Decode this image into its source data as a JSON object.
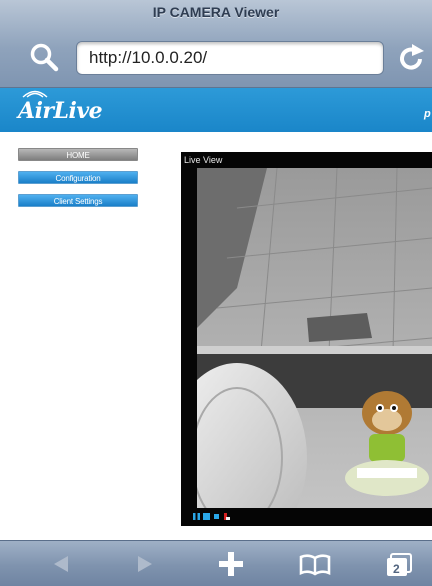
{
  "browser": {
    "title": "IP CAMERA Viewer",
    "url": "http://10.0.0.20/",
    "tab_count": "2"
  },
  "brand": {
    "logo_text": "AirLive",
    "edge_text": "p"
  },
  "sidebar": {
    "items": [
      {
        "label": "HOME"
      },
      {
        "label": "Configuration"
      },
      {
        "label": "Client Settings"
      }
    ]
  },
  "live_view": {
    "label": "Live View"
  },
  "icons": {
    "search": "search-icon",
    "reload": "reload-icon",
    "back": "back-arrow-icon",
    "forward": "forward-arrow-icon",
    "add": "plus-icon",
    "bookmarks": "book-icon",
    "tabs": "tabs-icon"
  },
  "colors": {
    "brand_blue": "#1a86c9",
    "toolbar": "#8fa3bc",
    "video_bg": "#050505"
  }
}
